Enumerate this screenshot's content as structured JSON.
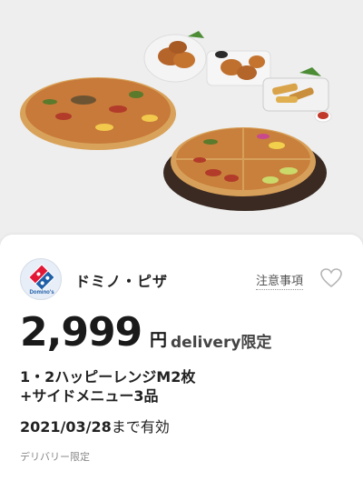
{
  "hero": {
    "image": "product-photo"
  },
  "coupon": {
    "brand": "ドミノ・ピザ",
    "logo_text": "Domino's",
    "notice_label": "注意事項",
    "price_amount": "2,999",
    "price_unit": "円",
    "price_note": "delivery限定",
    "description_line1": "1・2ハッピーレンジM2枚",
    "description_line2": "+サイドメニュー3品",
    "validity_date": "2021/03/28",
    "validity_suffix": "まで有効",
    "small_note": "デリバリー限定"
  },
  "colors": {
    "brand_blue": "#1f5fa8",
    "brand_red": "#e31837"
  }
}
